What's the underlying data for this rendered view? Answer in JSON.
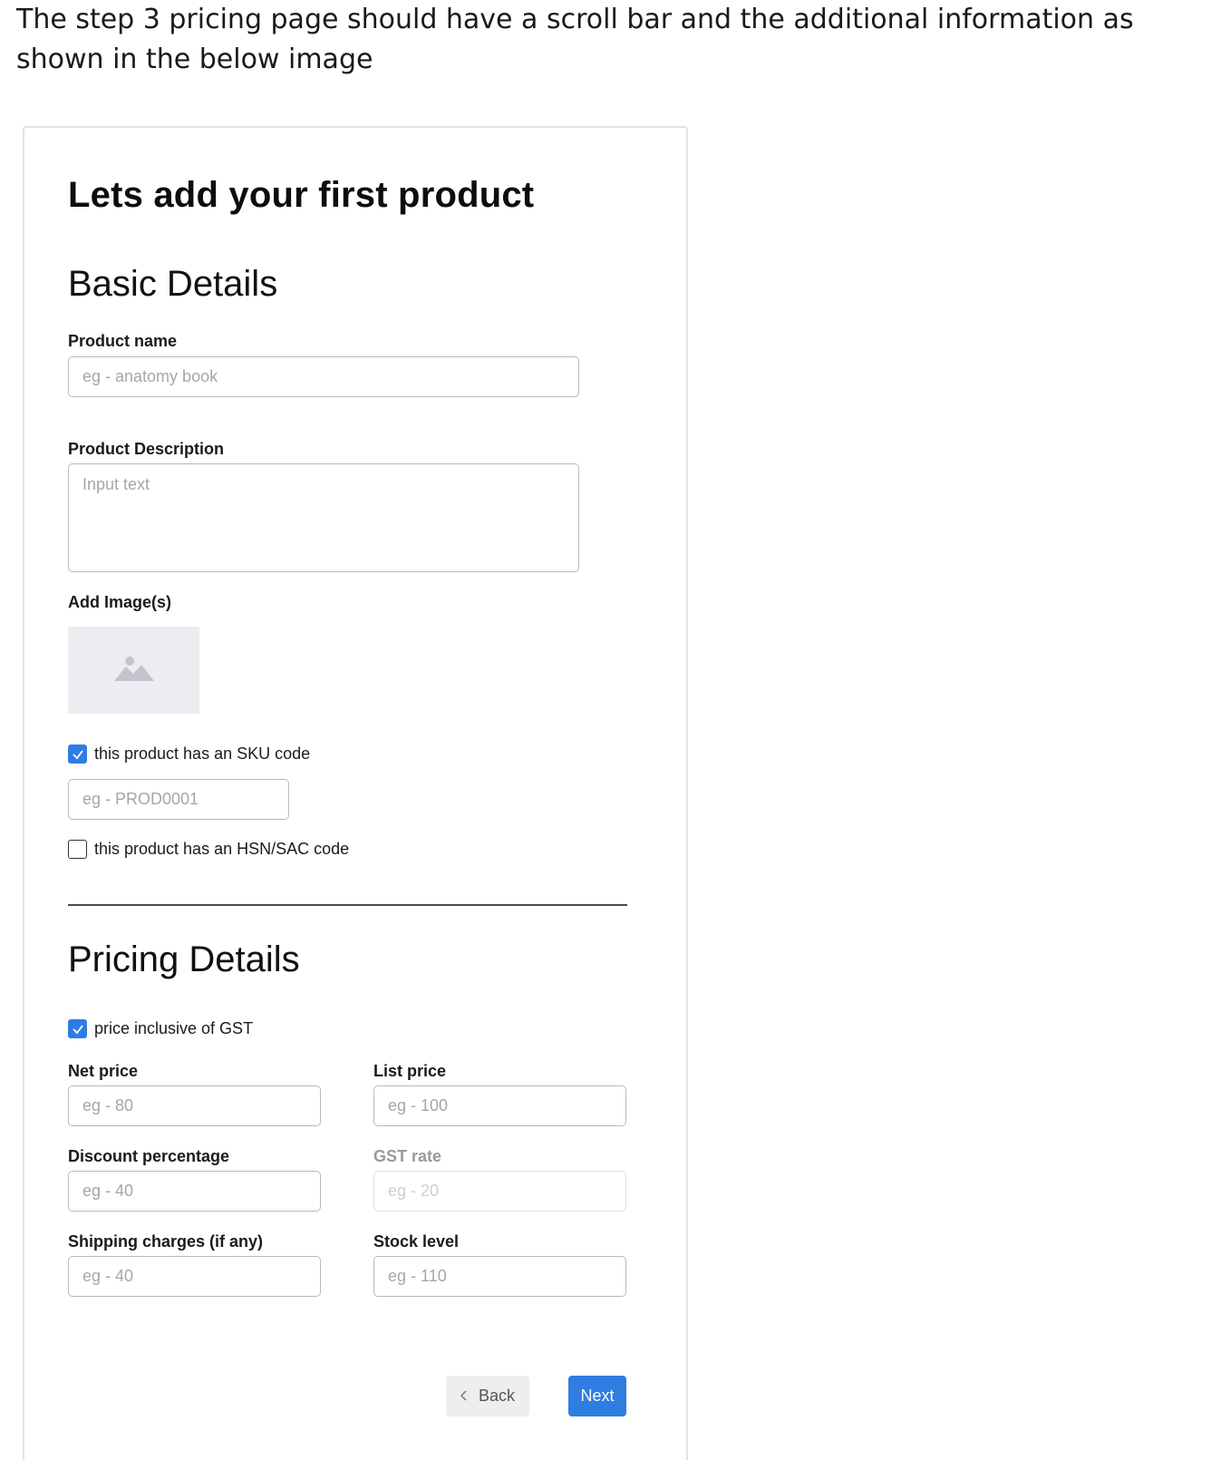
{
  "intro": {
    "text": "The step 3 pricing page should have a scroll bar and the additional information as shown in the below image"
  },
  "form": {
    "title": "Lets add your first product",
    "basic": {
      "heading": "Basic Details",
      "product_name_label": "Product name",
      "product_name_placeholder": "eg - anatomy book",
      "description_label": "Product Description",
      "description_placeholder": "Input text",
      "images_label": "Add Image(s)",
      "sku_checkbox_label": "this product has an SKU code",
      "sku_checked": true,
      "sku_placeholder": "eg - PROD0001",
      "hsn_checkbox_label": "this product has an HSN/SAC code",
      "hsn_checked": false
    },
    "pricing": {
      "heading": "Pricing Details",
      "gst_checkbox_label": "price inclusive of GST",
      "gst_checked": true,
      "net_price_label": "Net price",
      "net_price_placeholder": "eg - 80",
      "list_price_label": "List price",
      "list_price_placeholder": "eg - 100",
      "discount_label": "Discount percentage",
      "discount_placeholder": "eg - 40",
      "gst_rate_label": "GST rate",
      "gst_rate_placeholder": "eg - 20",
      "shipping_label": "Shipping charges (if any)",
      "shipping_placeholder": "eg - 40",
      "stock_label": "Stock level",
      "stock_placeholder": "eg - 110"
    },
    "buttons": {
      "back": "Back",
      "next": "Next"
    }
  },
  "colors": {
    "accent": "#2f7de1",
    "image_placeholder_bg": "#ececf1",
    "field_border": "#b9b9bd"
  },
  "icons": {
    "image_placeholder": "image-icon",
    "check": "check-icon",
    "back": "chevron-left-icon"
  }
}
